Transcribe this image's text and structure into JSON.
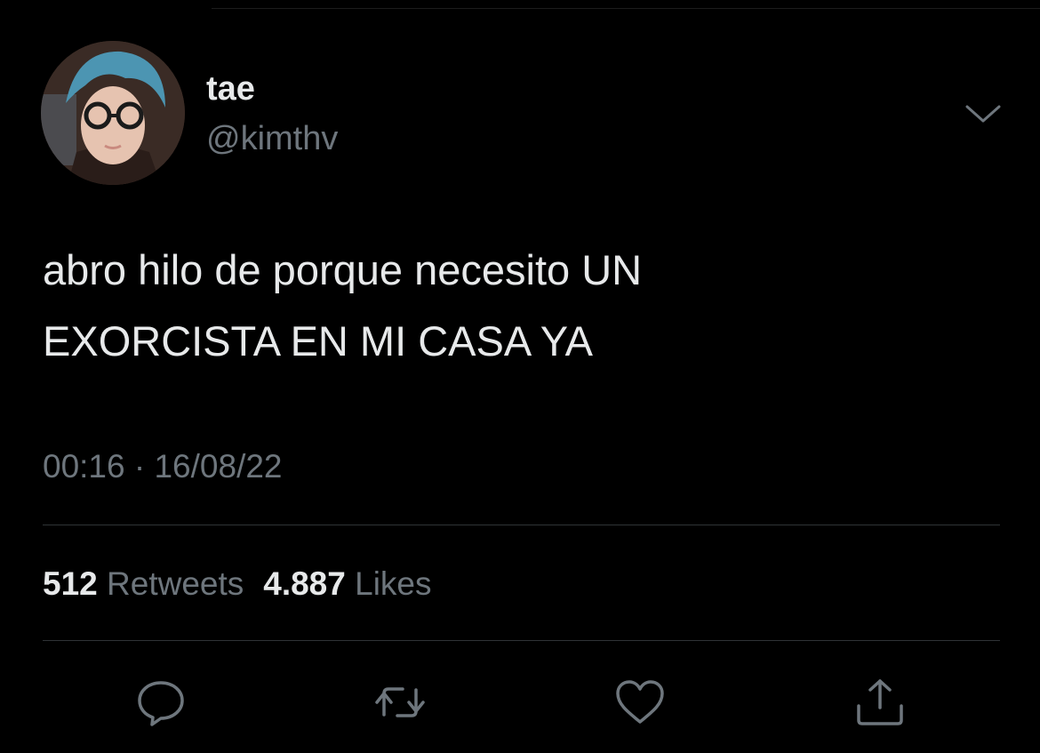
{
  "tweet": {
    "display_name": "tae",
    "handle": "@kimthv",
    "text": "abro hilo de porque necesito UN\nEXORCISTA EN MI CASA YA",
    "time": "00:16",
    "separator": "·",
    "date": "16/08/22",
    "retweets_count": "512",
    "retweets_label": "Retweets",
    "likes_count": "4.887",
    "likes_label": "Likes"
  },
  "icons": {
    "more": "chevron-down-icon",
    "reply": "reply-icon",
    "retweet": "retweet-icon",
    "like": "heart-icon",
    "share": "share-icon"
  },
  "colors": {
    "background": "#000000",
    "primary_text": "#e7e9ea",
    "secondary_text": "#6e767d",
    "divider": "#2f3336"
  }
}
